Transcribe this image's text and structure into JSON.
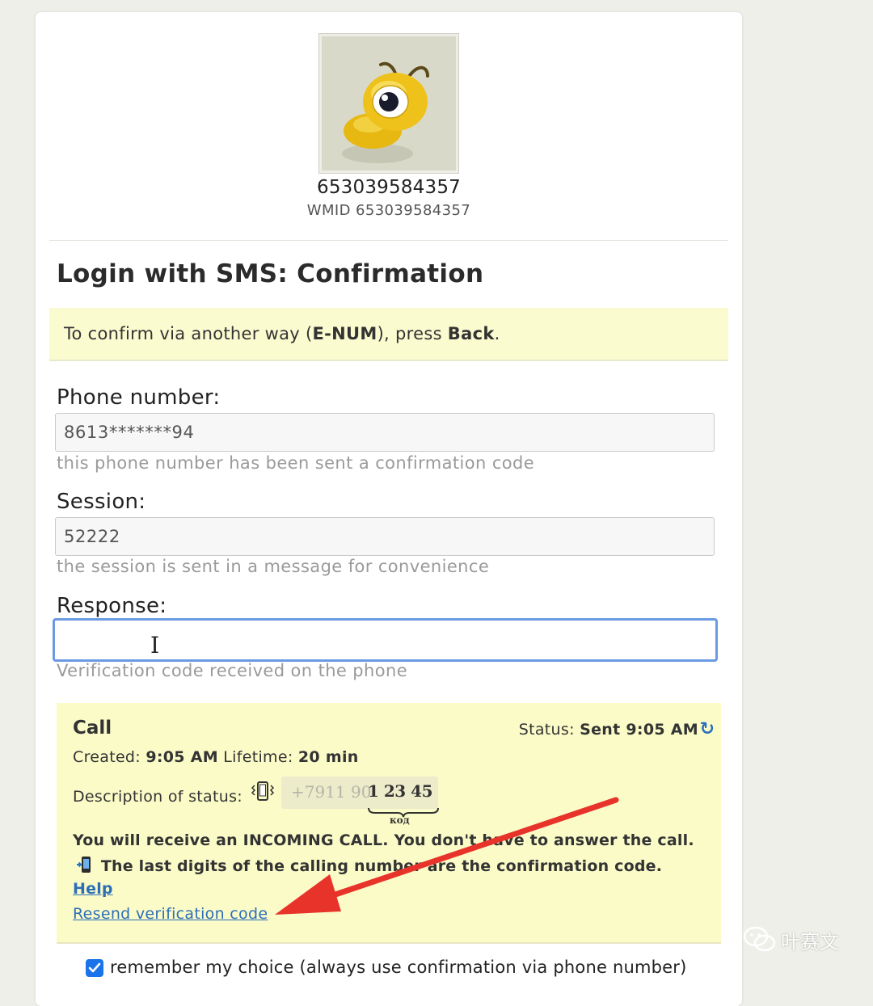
{
  "profile": {
    "user_id": "653039584357",
    "wmid": "WMID 653039584357",
    "avatar_icon": "ant-mascot-icon"
  },
  "page": {
    "title": "Login with SMS: Confirmation"
  },
  "notice": {
    "text_1": "To confirm via another way (",
    "method": "E-NUM",
    "text_2": "), press ",
    "back": "Back",
    "text_3": "."
  },
  "form": {
    "phone": {
      "label": "Phone number:",
      "value": "8613*******94",
      "hint": "this phone number has been sent a confirmation code"
    },
    "session": {
      "label": "Session:",
      "value": "52222",
      "hint": "the session is sent in a message for convenience"
    },
    "response": {
      "label": "Response:",
      "value": "",
      "hint": "Verification code received on the phone"
    }
  },
  "call": {
    "title": "Call",
    "status_label": "Status: ",
    "status_value": "Sent 9:05 AM",
    "created_label": "Created: ",
    "created_value": "9:05 AM",
    "lifetime_label": " Lifetime: ",
    "lifetime_value": "20 min",
    "desc_label": "Description of status:",
    "number_prefix": "+7911 90",
    "number_code": "1 23 45",
    "code_label": "код",
    "description_1": "You will receive an INCOMING CALL. You don't have to answer the call.",
    "description_2": "The last digits of the calling number are the confirmation code.",
    "help": "Help",
    "resend": "Resend verification code"
  },
  "remember": {
    "label": "remember my choice (always use confirmation via phone number)",
    "checked": true
  },
  "watermark": {
    "text": "叶赛文",
    "icon": "wechat-icon"
  },
  "colors": {
    "notice_bg": "#fbfbd0",
    "focus_border": "#6b9ae3",
    "link": "#2c6fb8",
    "arrow": "#e8332a",
    "checkbox": "#1a73e8"
  }
}
